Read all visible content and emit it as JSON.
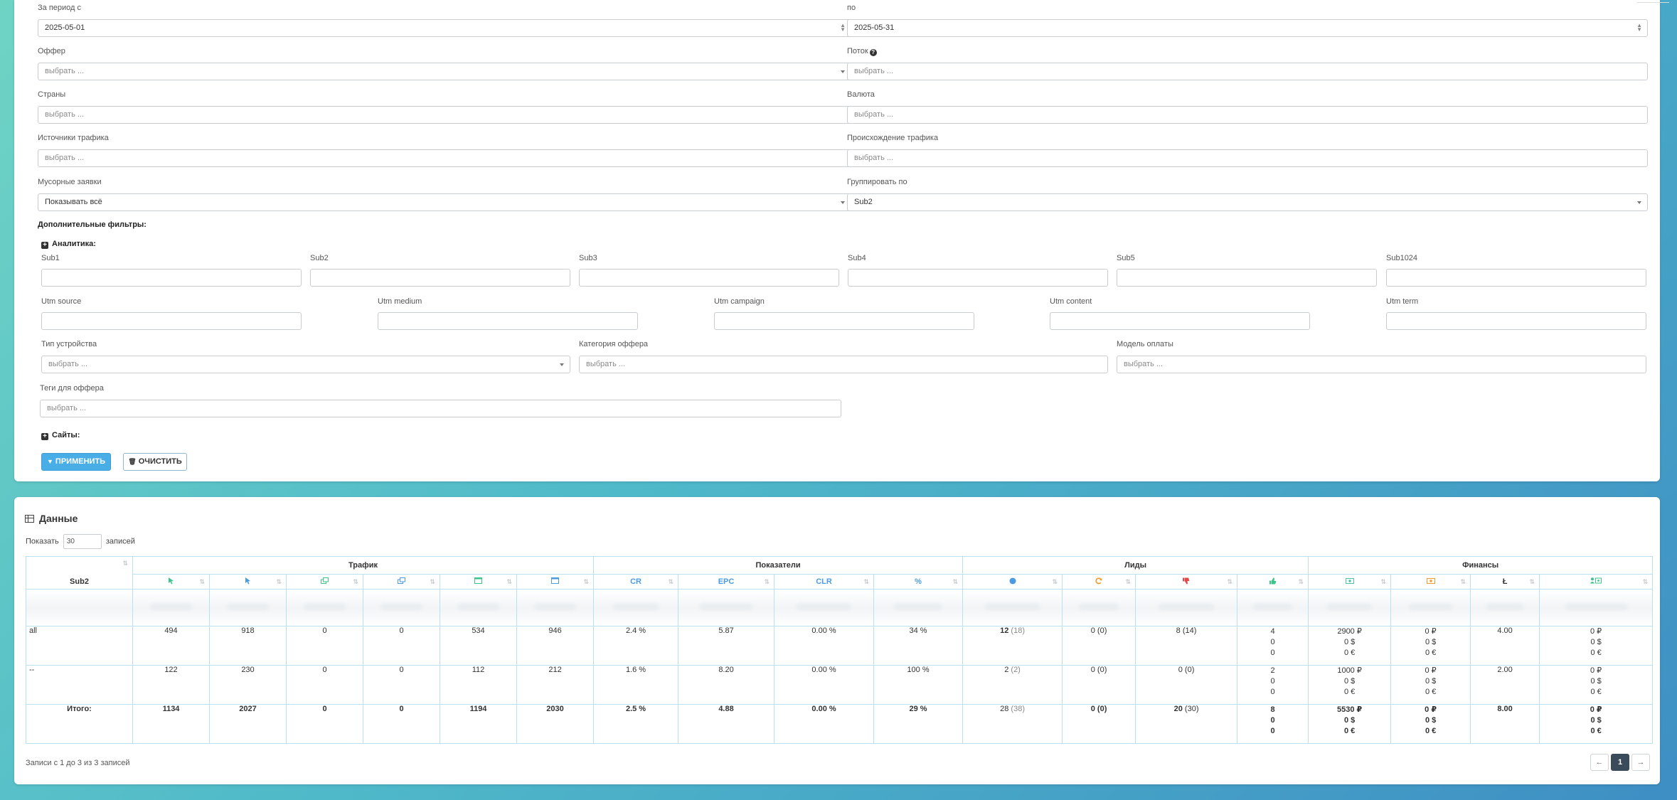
{
  "filters": {
    "period_from_label": "За период с",
    "period_from_value": "2025-05-01",
    "period_to_label": "по",
    "period_to_value": "2025-05-31",
    "offer_label": "Оффер",
    "offer_placeholder": "выбрать ...",
    "stream_label": "Поток",
    "stream_placeholder": "выбрать ...",
    "countries_label": "Страны",
    "countries_placeholder": "выбрать ...",
    "currency_label": "Валюта",
    "currency_placeholder": "выбрать ...",
    "traffic_sources_label": "Источники трафика",
    "traffic_sources_placeholder": "выбрать ...",
    "traffic_origin_label": "Происхождение трафика",
    "traffic_origin_placeholder": "выбрать ...",
    "junk_label": "Мусорные заявки",
    "junk_value": "Показывать всё",
    "group_by_label": "Группировать по",
    "group_by_value": "Sub2",
    "extra_filters_title": "Дополнительные фильтры:",
    "analytics_title": "Аналитика:",
    "subs": [
      "Sub1",
      "Sub2",
      "Sub3",
      "Sub4",
      "Sub5",
      "Sub1024"
    ],
    "utms": [
      "Utm source",
      "Utm medium",
      "Utm campaign",
      "Utm content",
      "Utm term"
    ],
    "device_label": "Тип устройства",
    "device_placeholder": "выбрать ...",
    "offer_category_label": "Категория оффера",
    "offer_category_placeholder": "выбрать ...",
    "payment_model_label": "Модель оплаты",
    "payment_model_placeholder": "выбрать ...",
    "offer_tags_label": "Теги для оффера",
    "offer_tags_placeholder": "выбрать ...",
    "sites_title": "Сайты:",
    "apply_label": "ПРИМЕНИТЬ",
    "clear_label": "ОЧИСТИТЬ"
  },
  "data_section": {
    "title": "Данные",
    "show_label": "Показать",
    "page_length": "30",
    "records_label": "записей",
    "groups": [
      "Трафик",
      "Показатели",
      "Лиды",
      "Финансы"
    ],
    "group_col_label": "Sub2",
    "metric_labels": [
      "CR",
      "EPC",
      "CLR",
      "%"
    ],
    "rows": [
      {
        "name": "all",
        "c1": "494",
        "c2": "918",
        "c3": "0",
        "c4": "0",
        "c5": "534",
        "c6": "946",
        "cr": "2.4 %",
        "epc": "5.87",
        "clr": "0.00 %",
        "pct": "34 %",
        "l1": "12",
        "l1b": "(18)",
        "l2": "0 (0)",
        "l3": "8 (14)",
        "l4": [
          "4",
          "0",
          "0"
        ],
        "f1": [
          "2900 ₽",
          "0 $",
          "0 €"
        ],
        "f2": [
          "0 ₽",
          "0 $",
          "0 €"
        ],
        "f3": "4.00",
        "f4": [
          "0 ₽",
          "0 $",
          "0 €"
        ]
      },
      {
        "name": "--",
        "c1": "122",
        "c2": "230",
        "c3": "0",
        "c4": "0",
        "c5": "112",
        "c6": "212",
        "cr": "1.6 %",
        "epc": "8.20",
        "clr": "0.00 %",
        "pct": "100 %",
        "l1": "2",
        "l1b": "(2)",
        "l2": "0 (0)",
        "l3": "0 (0)",
        "l4": [
          "2",
          "0",
          "0"
        ],
        "f1": [
          "1000 ₽",
          "0 $",
          "0 €"
        ],
        "f2": [
          "0 ₽",
          "0 $",
          "0 €"
        ],
        "f3": "2.00",
        "f4": [
          "0 ₽",
          "0 $",
          "0 €"
        ]
      }
    ],
    "total": {
      "name": "Итого:",
      "c1": "1134",
      "c2": "2027",
      "c3": "0",
      "c4": "0",
      "c5": "1194",
      "c6": "2030",
      "cr": "2.5 %",
      "epc": "4.88",
      "clr": "0.00 %",
      "pct": "29 %",
      "l1": "28",
      "l1b": "(38)",
      "l2": "0 (0)",
      "l3": "20",
      "l3b": "(30)",
      "l4": [
        "8",
        "0",
        "0"
      ],
      "f1": [
        "5530 ₽",
        "0 $",
        "0 €"
      ],
      "f2": [
        "0 ₽",
        "0 $",
        "0 €"
      ],
      "f3": "8.00",
      "f4": [
        "0 ₽",
        "0 $",
        "0 €"
      ]
    },
    "info": "Записи с 1 до 3 из 3 записей",
    "pager": {
      "prev": "←",
      "current": "1",
      "next": "→"
    }
  },
  "colors": {
    "accent": "#4aaee6",
    "icon_green": "#3cc48a",
    "icon_blue": "#4a9be0",
    "icon_orange": "#f39a2b",
    "icon_red": "#e24b4b",
    "icon_teal": "#4cc4a8"
  }
}
